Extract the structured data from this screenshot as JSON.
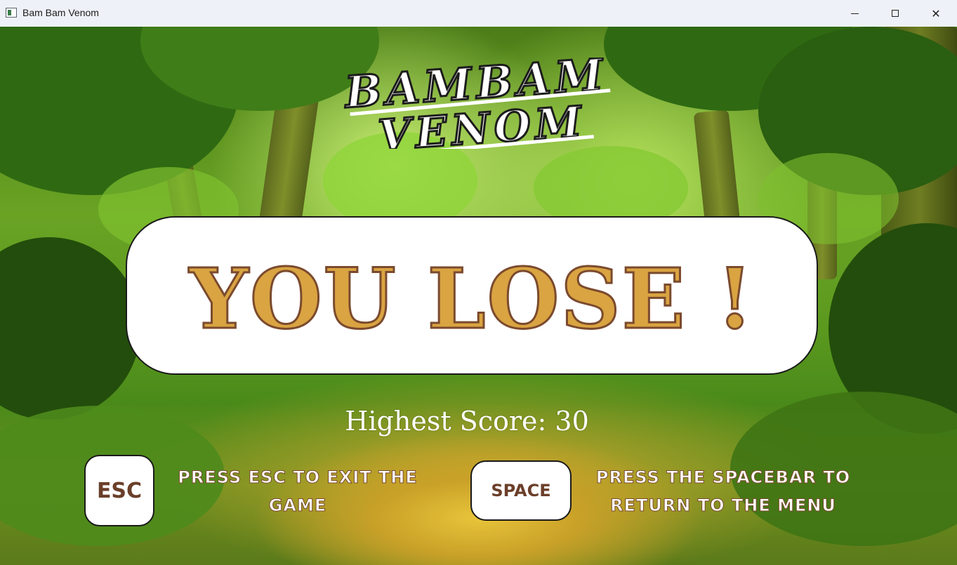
{
  "window": {
    "title": "Bam Bam Venom",
    "minimize_icon": "minimize-icon",
    "maximize_icon": "maximize-icon",
    "close_icon": "close-icon"
  },
  "game": {
    "logo": {
      "line1": "BAMBAM",
      "line2": "VENOM"
    },
    "result_text": "YOU LOSE !",
    "highest_score_text": "Highest Score: 30",
    "highest_score_value": 30,
    "esc_key_label": "ESC",
    "esc_hint": "Press ESC to exit the game",
    "space_key_label": "SPACE",
    "space_hint": "Press the spacebar to return to the menu"
  },
  "colors": {
    "result_fill": "#d9a441",
    "result_outline": "#7b4a2e",
    "key_text": "#6b3f2a",
    "panel_bg": "#ffffff"
  }
}
